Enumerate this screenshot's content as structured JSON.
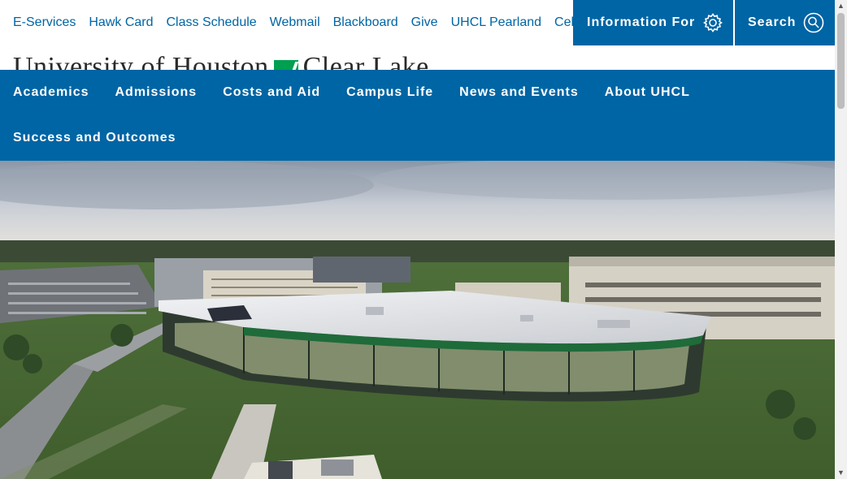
{
  "utility": {
    "links": [
      "E-Services",
      "Hawk Card",
      "Class Schedule",
      "Webmail",
      "Blackboard",
      "Give",
      "UHCL Pearland",
      "Cel"
    ],
    "info_label": "Information For",
    "search_label": "Search"
  },
  "logo": {
    "part1": "University of Houston",
    "part2": "Clear Lake"
  },
  "nav": {
    "items": [
      "Academics",
      "Admissions",
      "Costs and Aid",
      "Campus Life",
      "News and Events",
      "About UHCL",
      "Success and Outcomes"
    ]
  },
  "colors": {
    "brand_blue": "#0065a4",
    "brand_green": "#00a050",
    "link_blue": "#0065a4"
  },
  "icons": {
    "info": "gear-icon",
    "search": "search-icon"
  }
}
